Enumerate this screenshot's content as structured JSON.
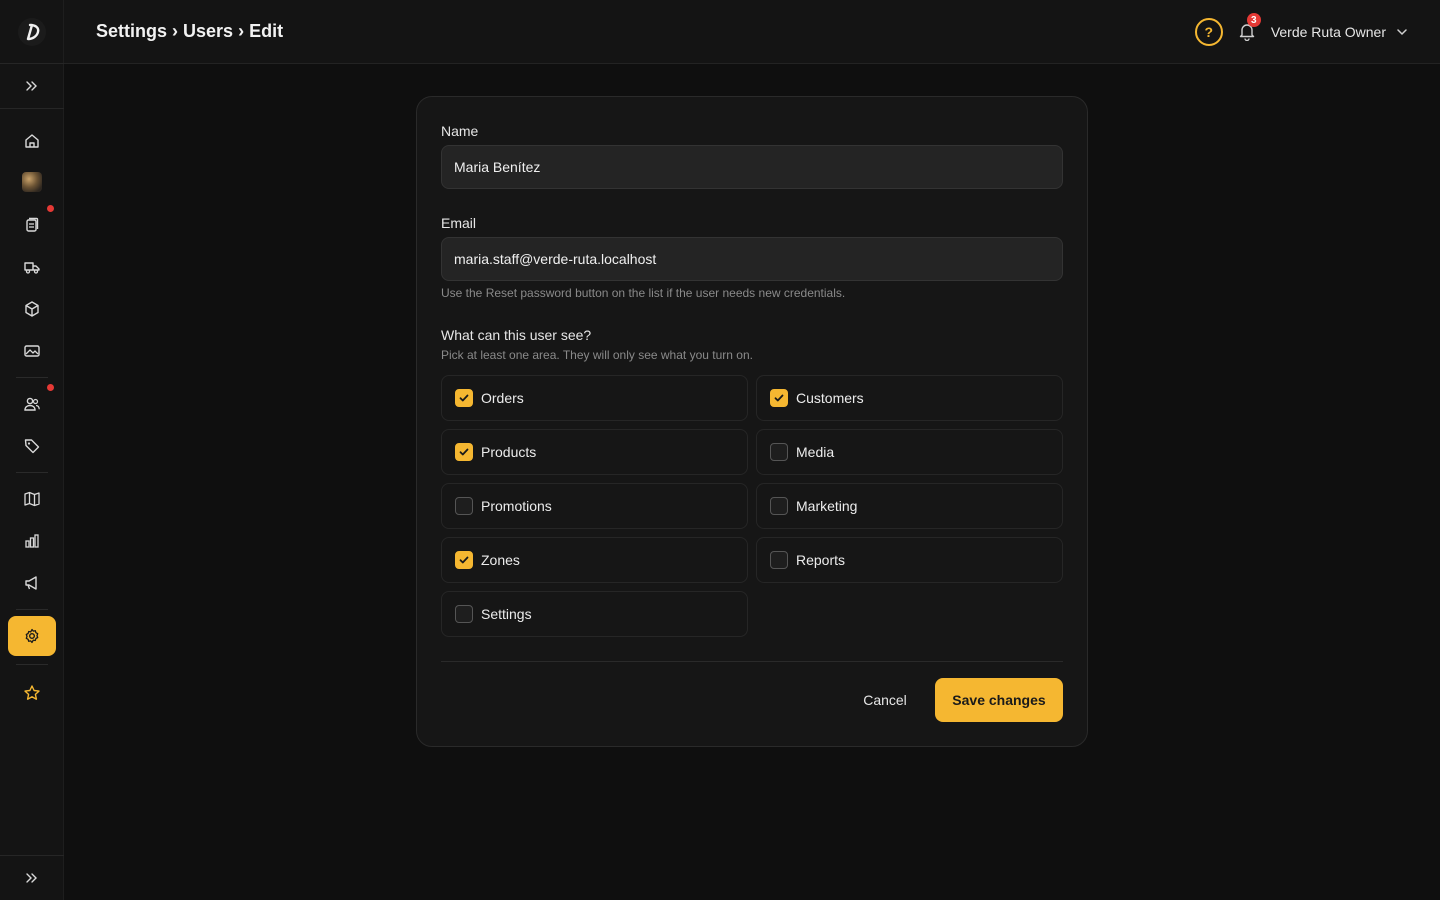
{
  "header": {
    "breadcrumb": [
      "Settings",
      "Users",
      "Edit"
    ],
    "separator": "›",
    "help_glyph": "?",
    "notification_count": "3",
    "user_name": "Verde Ruta Owner"
  },
  "sidebar": {
    "icons": [
      "logo-icon",
      "expand-icon",
      "home-icon",
      "store-avatar",
      "orders-icon",
      "delivery-truck-icon",
      "box-icon",
      "media-icon",
      "customers-icon",
      "tag-icon",
      "map-icon",
      "reports-chart-icon",
      "megaphone-icon",
      "gear-icon",
      "star-icon",
      "expand-icon"
    ],
    "accent": "#f5b731",
    "badge_color": "#e53935"
  },
  "form": {
    "name_label": "Name",
    "name_value": "Maria Benítez",
    "email_label": "Email",
    "email_value": "maria.staff@verde-ruta.localhost",
    "email_hint": "Use the Reset password button on the list if the user needs new credentials.",
    "permissions_title": "What can this user see?",
    "permissions_hint": "Pick at least one area. They will only see what you turn on.",
    "permissions": [
      {
        "label": "Orders",
        "checked": true
      },
      {
        "label": "Customers",
        "checked": true
      },
      {
        "label": "Products",
        "checked": true
      },
      {
        "label": "Media",
        "checked": false
      },
      {
        "label": "Promotions",
        "checked": false
      },
      {
        "label": "Marketing",
        "checked": false
      },
      {
        "label": "Zones",
        "checked": true
      },
      {
        "label": "Reports",
        "checked": false
      },
      {
        "label": "Settings",
        "checked": false
      }
    ],
    "cancel_label": "Cancel",
    "save_label": "Save changes"
  }
}
